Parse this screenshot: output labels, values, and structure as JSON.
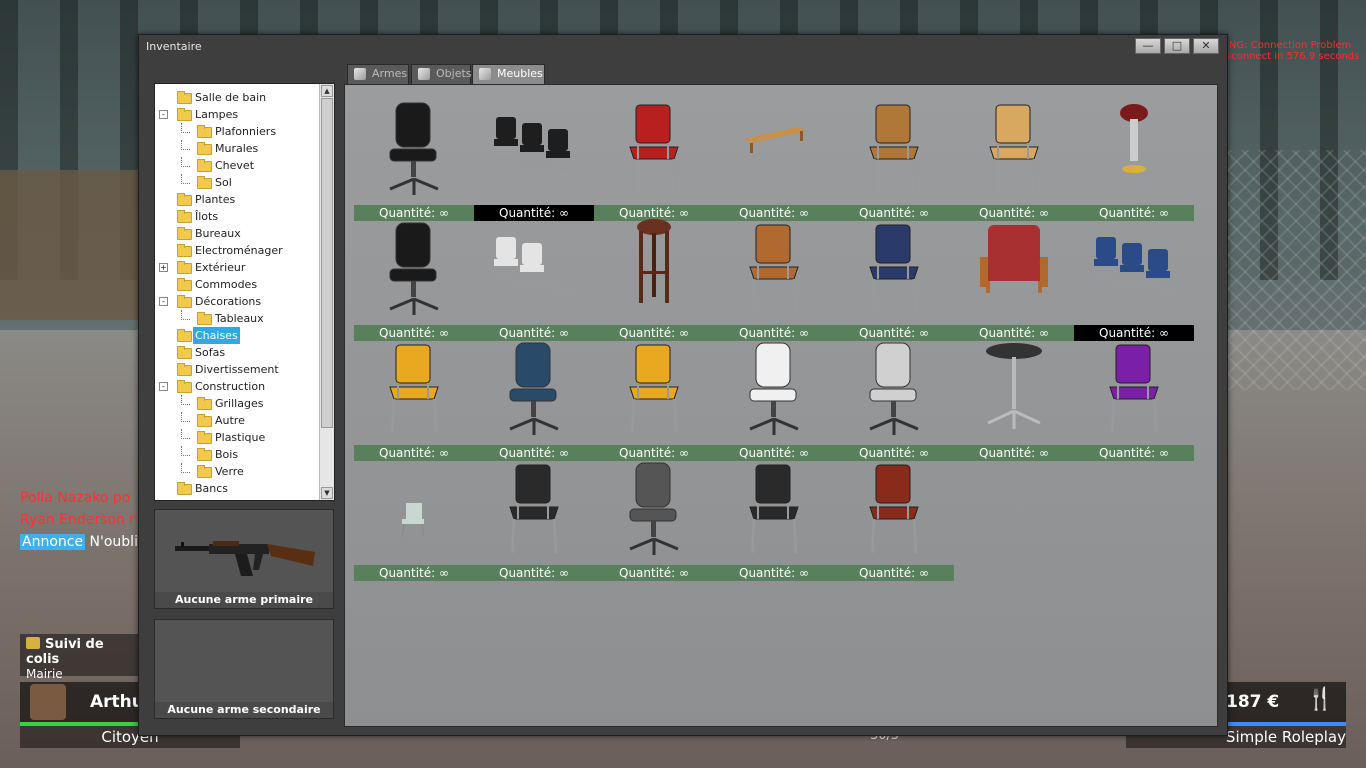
{
  "background": {
    "warning_lines": [
      "ING:  Connection Problem",
      "sconnect in 576.9 seconds"
    ],
    "chat": {
      "line1": "Polla Nazako po",
      "line2": "Ryan Enderson r",
      "annonce_tag": "Annonce",
      "annonce_text": "N'oubli"
    },
    "hud": {
      "colis_title": "Suivi de colis",
      "colis_sub": "Mairie",
      "player_name": "Arthur",
      "job": "Citoyen",
      "money": "187 €",
      "server": "Simple Roleplay",
      "ammo": "30/5",
      "food_icon": "fork-knife-icon"
    }
  },
  "window": {
    "title": "Inventaire",
    "controls": {
      "minimize": "—",
      "maximize": "□",
      "close": "✕"
    }
  },
  "tabs": [
    {
      "label": "Armes",
      "icon": "cube-icon"
    },
    {
      "label": "Objets",
      "icon": "cube-icon"
    },
    {
      "label": "Meubles",
      "icon": "cube-icon"
    }
  ],
  "active_tab": "Meubles",
  "tree": [
    {
      "label": "Salle de bain",
      "indent": 0
    },
    {
      "label": "Lampes",
      "indent": 0,
      "toggle": "-"
    },
    {
      "label": "Plafonniers",
      "indent": 1
    },
    {
      "label": "Murales",
      "indent": 1
    },
    {
      "label": "Chevet",
      "indent": 1
    },
    {
      "label": "Sol",
      "indent": 1
    },
    {
      "label": "Plantes",
      "indent": 0
    },
    {
      "label": "Îlots",
      "indent": 0
    },
    {
      "label": "Bureaux",
      "indent": 0
    },
    {
      "label": "Electroménager",
      "indent": 0
    },
    {
      "label": "Extérieur",
      "indent": 0,
      "toggle": "+"
    },
    {
      "label": "Commodes",
      "indent": 0
    },
    {
      "label": "Décorations",
      "indent": 0,
      "toggle": "-"
    },
    {
      "label": "Tableaux",
      "indent": 1
    },
    {
      "label": "Chaises",
      "indent": 0,
      "selected": true
    },
    {
      "label": "Sofas",
      "indent": 0
    },
    {
      "label": "Divertissement",
      "indent": 0
    },
    {
      "label": "Construction",
      "indent": 0,
      "toggle": "-"
    },
    {
      "label": "Grillages",
      "indent": 1
    },
    {
      "label": "Autre",
      "indent": 1
    },
    {
      "label": "Plastique",
      "indent": 1
    },
    {
      "label": "Bois",
      "indent": 1
    },
    {
      "label": "Verre",
      "indent": 1
    },
    {
      "label": "Bancs",
      "indent": 0
    }
  ],
  "slots": {
    "primary_label": "Aucune arme primaire",
    "secondary_label": "Aucune arme secondaire"
  },
  "items": [
    {
      "name": "chair-black-office",
      "qty": "Quantité: ∞"
    },
    {
      "name": "chair-waiting-bench-black",
      "qty": "Quantité: ∞",
      "highlight": true
    },
    {
      "name": "chair-red",
      "qty": "Quantité: ∞"
    },
    {
      "name": "bench-wood-low",
      "qty": "Quantité: ∞"
    },
    {
      "name": "chair-school-wood-dark",
      "qty": "Quantité: ∞"
    },
    {
      "name": "chair-school-wood-light",
      "qty": "Quantité: ∞"
    },
    {
      "name": "bar-stool-red",
      "qty": "Quantité: ∞"
    },
    {
      "name": "chair-executive-black",
      "qty": "Quantité: ∞"
    },
    {
      "name": "chair-waiting-white",
      "qty": "Quantité: ∞"
    },
    {
      "name": "stool-wood",
      "qty": "Quantité: ∞"
    },
    {
      "name": "chair-wood",
      "qty": "Quantité: ∞"
    },
    {
      "name": "chair-blue",
      "qty": "Quantité: ∞"
    },
    {
      "name": "armchair-red",
      "qty": "Quantité: ∞"
    },
    {
      "name": "bench-blue-seats",
      "qty": "Quantité: ∞",
      "highlight": true
    },
    {
      "name": "chair-yellow-black",
      "qty": "Quantité: ∞"
    },
    {
      "name": "chair-office-blue",
      "qty": "Quantité: ∞"
    },
    {
      "name": "chair-yellow-black-2",
      "qty": "Quantité: ∞"
    },
    {
      "name": "chair-office-white",
      "qty": "Quantité: ∞"
    },
    {
      "name": "chair-office-grey",
      "qty": "Quantité: ∞"
    },
    {
      "name": "stool-round-grey",
      "qty": "Quantité: ∞"
    },
    {
      "name": "chair-purple",
      "qty": "Quantité: ∞"
    },
    {
      "name": "chair-small-white",
      "qty": "Quantité: ∞"
    },
    {
      "name": "chair-cantilever",
      "qty": "Quantité: ∞"
    },
    {
      "name": "chair-mesh-office",
      "qty": "Quantité: ∞"
    },
    {
      "name": "chair-folding",
      "qty": "Quantité: ∞"
    },
    {
      "name": "chair-bistro",
      "qty": "Quantité: ∞"
    }
  ],
  "colors": {
    "qty_bar": "#58805a",
    "qty_bar_highlight": "#000000",
    "tree_selection": "#2fa9e0",
    "window_bg": "#3e3e3e"
  }
}
